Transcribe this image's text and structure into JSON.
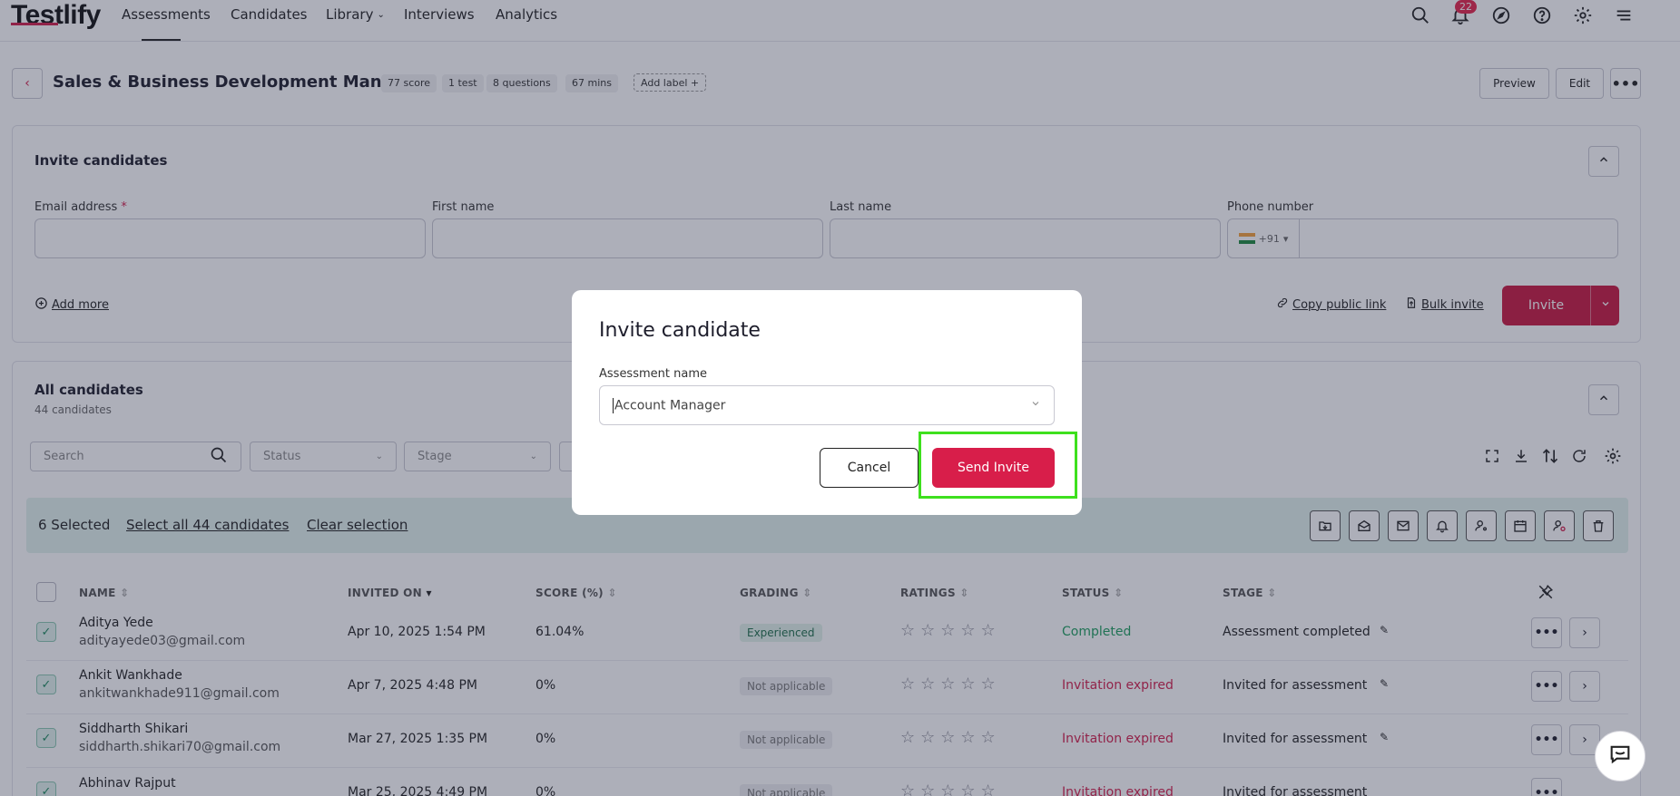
{
  "nav": {
    "logo": "Testlify",
    "items": [
      "Assessments",
      "Candidates",
      "Library",
      "Interviews",
      "Analytics"
    ],
    "notification_count": "22"
  },
  "header": {
    "title": "Sales & Business Development Manager",
    "chips": [
      "77 score",
      "1 test",
      "8 questions",
      "67 mins"
    ],
    "add_label": "Add label",
    "preview": "Preview",
    "edit": "Edit"
  },
  "invite": {
    "title": "Invite candidates",
    "email_label": "Email address",
    "first_name_label": "First name",
    "last_name_label": "Last name",
    "phone_label": "Phone number",
    "country_code": "+91",
    "add_more": "Add more",
    "copy_link": "Copy public link",
    "bulk_invite": "Bulk invite",
    "invite_button": "Invite"
  },
  "candidates": {
    "title": "All candidates",
    "count": "44 candidates",
    "search_placeholder": "Search",
    "status_filter": "Status",
    "stage_filter": "Stage",
    "selected_text": "6 Selected",
    "select_all": "Select all 44 candidates",
    "clear": "Clear selection",
    "columns": [
      "NAME",
      "INVITED ON",
      "SCORE (%)",
      "GRADING",
      "RATINGS",
      "STATUS",
      "STAGE"
    ],
    "rows": [
      {
        "name": "Aditya Yede",
        "email": "adityayede03@gmail.com",
        "invited": "Apr 10, 2025 1:54 PM",
        "score": "61.04%",
        "grading": "Experienced",
        "status": "Completed",
        "stage": "Assessment completed"
      },
      {
        "name": "Ankit Wankhade",
        "email": "ankitwankhade911@gmail.com",
        "invited": "Apr 7, 2025 4:48 PM",
        "score": "0%",
        "grading": "Not applicable",
        "status": "Invitation expired",
        "stage": "Invited for assessment"
      },
      {
        "name": "Siddharth Shikari",
        "email": "siddharth.shikari70@gmail.com",
        "invited": "Mar 27, 2025 1:35 PM",
        "score": "0%",
        "grading": "Not applicable",
        "status": "Invitation expired",
        "stage": "Invited for assessment"
      },
      {
        "name": "Abhinav Rajput",
        "email": "",
        "invited": "Mar 25, 2025 4:49 PM",
        "score": "0%",
        "grading": "Not applicable",
        "status": "Invitation expired",
        "stage": "Invited for assessment"
      }
    ]
  },
  "modal": {
    "title": "Invite candidate",
    "label": "Assessment name",
    "selected": "Account Manager",
    "cancel": "Cancel",
    "send": "Send Invite"
  },
  "colors": {
    "brand": "#d21e4b",
    "completed": "#1e9e5e",
    "expired": "#d21e4b",
    "highlight": "#3ee01e"
  }
}
